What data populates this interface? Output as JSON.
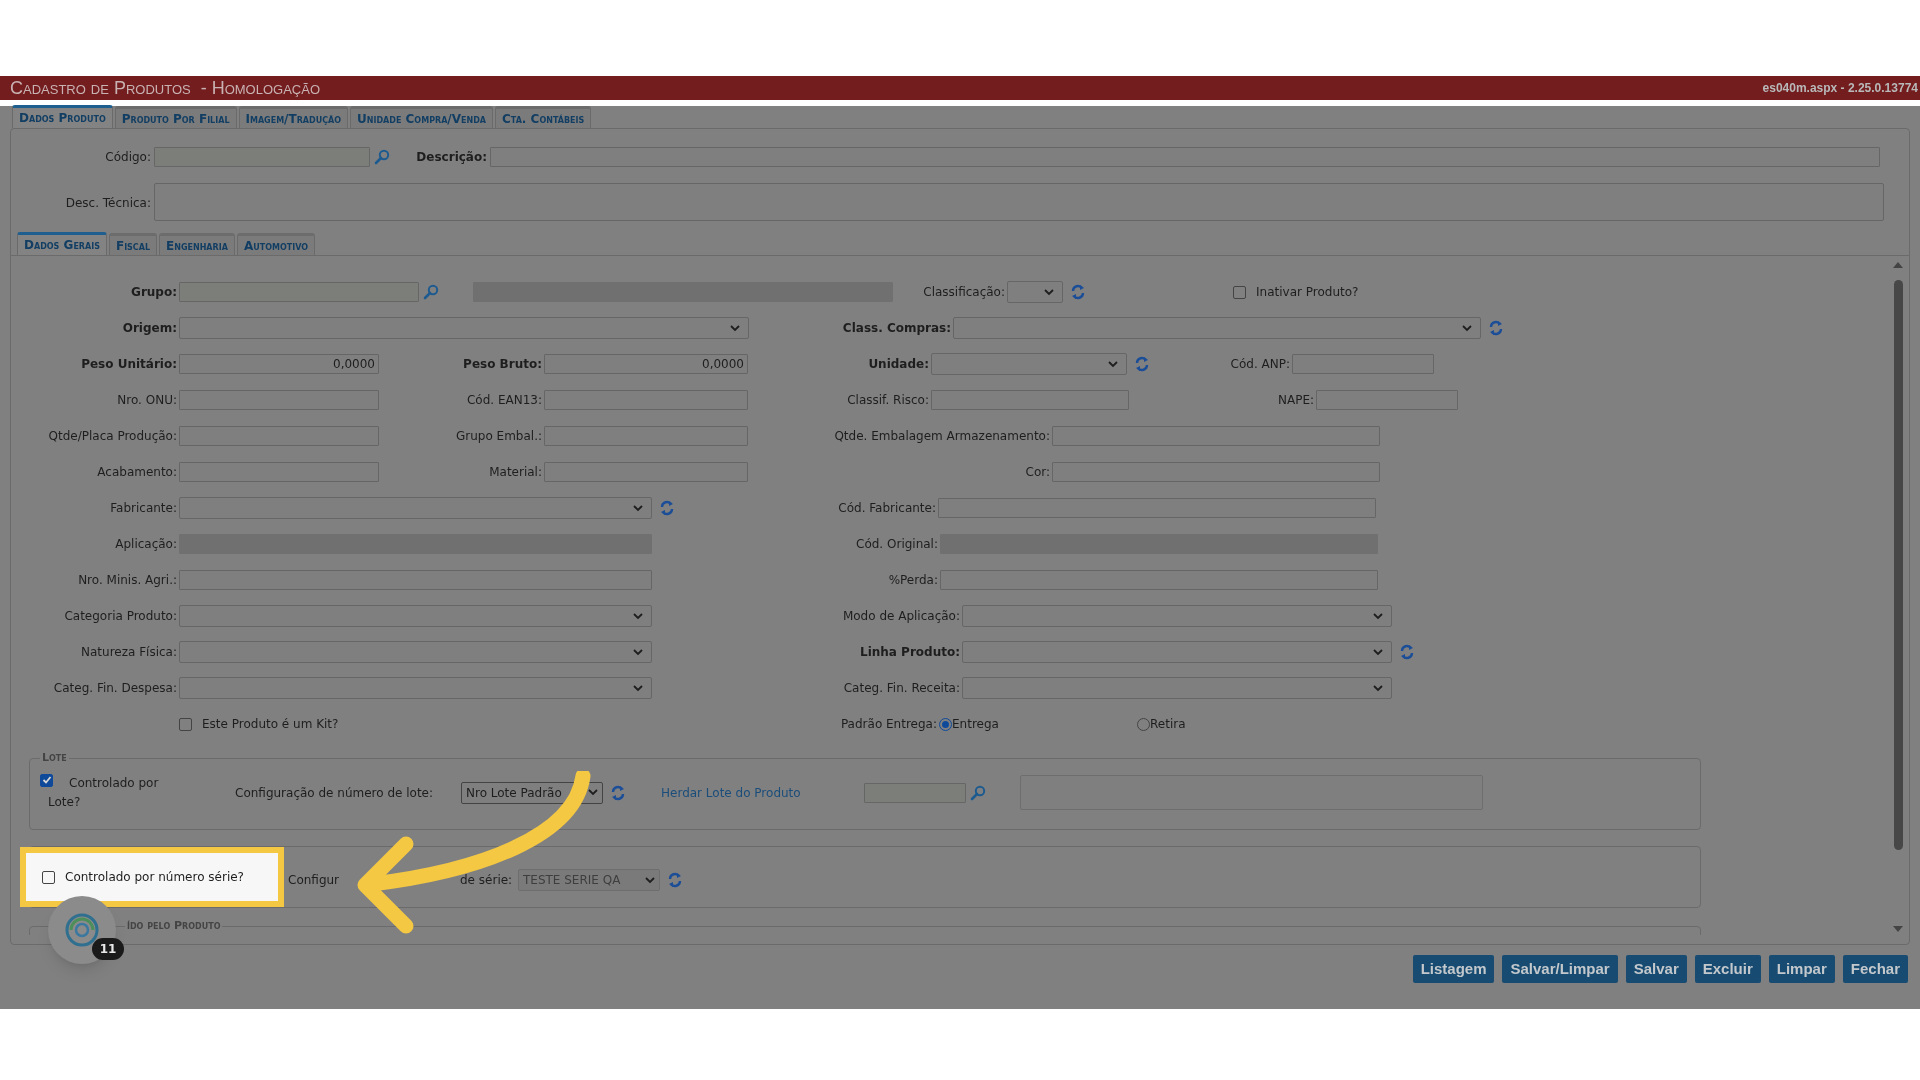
{
  "window": {
    "title": "Cadastro de Produtos",
    "subtitle": "- Homologação",
    "version": "es040m.aspx - 2.25.0.13774"
  },
  "tabs": [
    {
      "label": "Dados Produto",
      "selected": true
    },
    {
      "label": "Produto Por Filial",
      "selected": false
    },
    {
      "label": "Imagem/Tradução",
      "selected": false
    },
    {
      "label": "Unidade Compra/Venda",
      "selected": false
    },
    {
      "label": "Cta. Contábeis",
      "selected": false
    }
  ],
  "header": {
    "code_label": "Código:",
    "description_label": "Descrição:",
    "tech_label": "Desc. Técnica:"
  },
  "subtabs": [
    {
      "label": "Dados Gerais",
      "selected": true
    },
    {
      "label": "Fiscal",
      "selected": false
    },
    {
      "label": "Engenharia",
      "selected": false
    },
    {
      "label": "Automotivo",
      "selected": false
    }
  ],
  "form_rows": [
    [
      {
        "label": "Grupo:",
        "bold": true,
        "kind": "lookup"
      },
      {
        "kind": "text",
        "disabled": true
      },
      {
        "label": "Classificação:",
        "kind": "select",
        "refresh": true
      },
      {
        "kind": "checkbox",
        "text": "Inativar Produto?",
        "checked": false
      }
    ],
    [
      {
        "label": "Origem:",
        "bold": true,
        "kind": "select"
      },
      {
        "label": "Class. Compras:",
        "bold": true,
        "kind": "select",
        "refresh": true
      }
    ],
    [
      {
        "label": "Peso Unitário:",
        "bold": true,
        "kind": "text",
        "value": "0,0000"
      },
      {
        "label": "Peso Bruto:",
        "bold": true,
        "kind": "text",
        "value": "0,0000"
      },
      {
        "label": "Unidade:",
        "bold": true,
        "kind": "select",
        "refresh": true
      },
      {
        "label": "Cód. ANP:",
        "kind": "text"
      }
    ],
    [
      {
        "label": "Nro. ONU:",
        "kind": "text"
      },
      {
        "label": "Cód. EAN13:",
        "kind": "text"
      },
      {
        "label": "Classif. Risco:",
        "kind": "text"
      },
      {
        "label": "NAPE:",
        "kind": "text"
      }
    ],
    [
      {
        "label": "Qtde/Placa Produção:",
        "kind": "text"
      },
      {
        "label": "Grupo Embal.:",
        "kind": "text"
      },
      {
        "label": "Qtde. Embalagem Armazenamento:",
        "kind": "text"
      }
    ],
    [
      {
        "label": "Acabamento:",
        "kind": "text"
      },
      {
        "label": "Material:",
        "kind": "text"
      },
      {
        "label": "Cor:",
        "kind": "text"
      }
    ],
    [
      {
        "label": "Fabricante:",
        "kind": "select",
        "refresh": true
      },
      {
        "label": "Cód. Fabricante:",
        "kind": "text"
      }
    ],
    [
      {
        "label": "Aplicação:",
        "kind": "text",
        "disabled": true
      },
      {
        "label": "Cód. Original:",
        "kind": "text",
        "disabled": true
      }
    ],
    [
      {
        "label": "Nro. Minis. Agri.:",
        "kind": "text"
      },
      {
        "label": "%Perda:",
        "kind": "text"
      }
    ],
    [
      {
        "label": "Categoria Produto:",
        "kind": "select"
      },
      {
        "label": "Modo de Aplicação:",
        "kind": "select"
      }
    ],
    [
      {
        "label": "Natureza Física:",
        "kind": "select"
      },
      {
        "label": "Linha Produto:",
        "bold": true,
        "kind": "select",
        "refresh": true
      }
    ],
    [
      {
        "label": "Categ. Fin. Despesa:",
        "kind": "select"
      },
      {
        "label": "Categ. Fin. Receita:",
        "kind": "select"
      }
    ],
    [
      {
        "kind": "checkbox",
        "text": "Este Produto é um Kit?",
        "checked": false
      },
      {
        "label": "Padrão Entrega:",
        "kind": "radio_group",
        "options": [
          {
            "label": "Entrega",
            "selected": true
          },
          {
            "label": "Retira",
            "selected": false
          }
        ]
      }
    ]
  ],
  "lote": {
    "title": "Lote",
    "checkbox": {
      "text": "Controlado por Lote?",
      "checked": true
    },
    "config_label": "Configuração de número de lote:",
    "config_value": "Nro Lote Padrão",
    "link": "Herdar Lote do Produto"
  },
  "serie": {
    "checkbox": {
      "text": "Controlado por número série?",
      "checked": false
    },
    "config_label_start": "Configur",
    "config_label_end": "de série:",
    "config_value": "TESTE SERIE QA"
  },
  "third_section": {
    "title": "ído pelo Produto"
  },
  "assistant_badge": "11",
  "buttons": [
    "Listagem",
    "Salvar/Limpar",
    "Salvar",
    "Excluir",
    "Limpar",
    "Fechar"
  ]
}
